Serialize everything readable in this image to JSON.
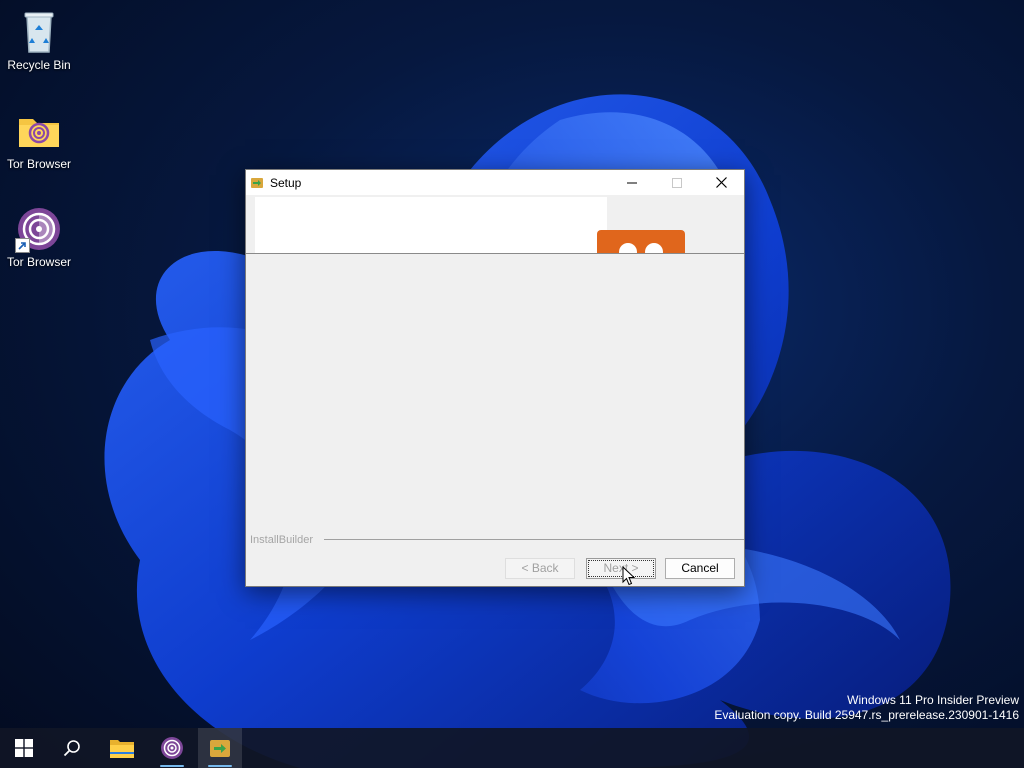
{
  "desktop": {
    "icons": [
      {
        "label": "Recycle Bin"
      },
      {
        "label": "Tor Browser"
      },
      {
        "label": "Tor Browser"
      }
    ]
  },
  "window": {
    "title": "Setup",
    "brand": "InstallBuilder",
    "buttons": {
      "back": "< Back",
      "next": "Next >",
      "cancel": "Cancel"
    }
  },
  "watermark": {
    "line1": "Windows 11 Pro Insider Preview",
    "line2": "Evaluation copy. Build 25947.rs_prerelease.230901-1416"
  },
  "taskbar": {
    "items": [
      "start-icon",
      "search-icon",
      "file-explorer-icon",
      "tor-browser-icon",
      "setup-app-icon"
    ]
  },
  "colors": {
    "accent": "#76b9ed",
    "logo_orange": "#e0661c",
    "tor_purple": "#7d4698"
  }
}
